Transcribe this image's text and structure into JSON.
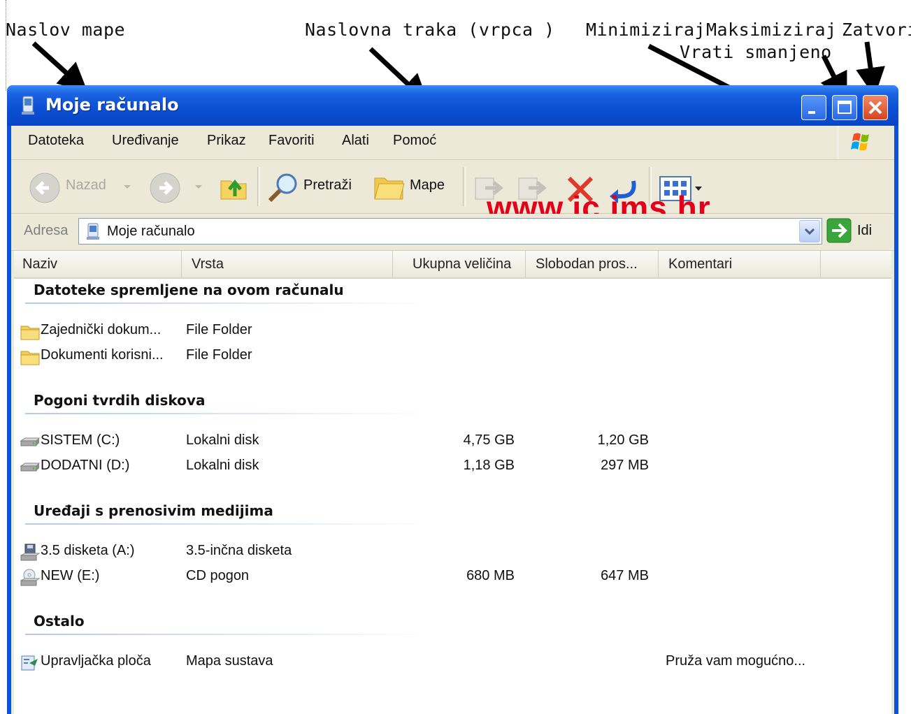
{
  "annotations": {
    "folder_title": "Naslov   mape",
    "title_bar": "Naslovna traka (vrpca )",
    "minimize": "Minimiziraj",
    "maximize": "Maksimiziraj",
    "restore": "Vrati smanjeno",
    "close": "Zatvori"
  },
  "window": {
    "title": "Moje računalo"
  },
  "menu": [
    {
      "label": "Datoteka"
    },
    {
      "label": "Uređivanje"
    },
    {
      "label": "Prikaz"
    },
    {
      "label": "Favoriti"
    },
    {
      "label": "Alati"
    },
    {
      "label": "Pomoć"
    }
  ],
  "toolbar": {
    "back_label": "Nazad",
    "search_label": "Pretraži",
    "folders_label": "Mape"
  },
  "watermark": "www.ic.ims.hr",
  "address": {
    "label": "Adresa",
    "value": "Moje računalo",
    "go_label": "Idi"
  },
  "columns": [
    "Naziv",
    "Vrsta",
    "Ukupna veličina",
    "Slobodan pros...",
    "Komentari"
  ],
  "groups": [
    {
      "title": "Datoteke spremljene na ovom računalu",
      "items": [
        {
          "icon": "folder-icon",
          "name": "Zajednički dokum...",
          "type": "File Folder",
          "size": "",
          "free": "",
          "comment": ""
        },
        {
          "icon": "folder-icon",
          "name": "Dokumenti korisni...",
          "type": "File Folder",
          "size": "",
          "free": "",
          "comment": ""
        }
      ]
    },
    {
      "title": "Pogoni tvrdih diskova",
      "items": [
        {
          "icon": "hard-drive-icon",
          "name": "SISTEM (C:)",
          "type": "Lokalni disk",
          "size": "4,75 GB",
          "free": "1,20 GB",
          "comment": ""
        },
        {
          "icon": "hard-drive-icon",
          "name": "DODATNI (D:)",
          "type": "Lokalni disk",
          "size": "1,18 GB",
          "free": "297 MB",
          "comment": ""
        }
      ]
    },
    {
      "title": "Uređaji s prenosivim medijima",
      "items": [
        {
          "icon": "floppy-drive-icon",
          "name": "3.5 disketa (A:)",
          "type": "3.5-inčna disketa",
          "size": "",
          "free": "",
          "comment": ""
        },
        {
          "icon": "cd-drive-icon",
          "name": "NEW (E:)",
          "type": "CD pogon",
          "size": "680 MB",
          "free": "647 MB",
          "comment": ""
        }
      ]
    },
    {
      "title": "Ostalo",
      "items": [
        {
          "icon": "control-panel-icon",
          "name": "Upravljačka ploča",
          "type": "Mapa sustava",
          "size": "",
          "free": "",
          "comment": "Pruža vam mogućno..."
        }
      ]
    }
  ]
}
